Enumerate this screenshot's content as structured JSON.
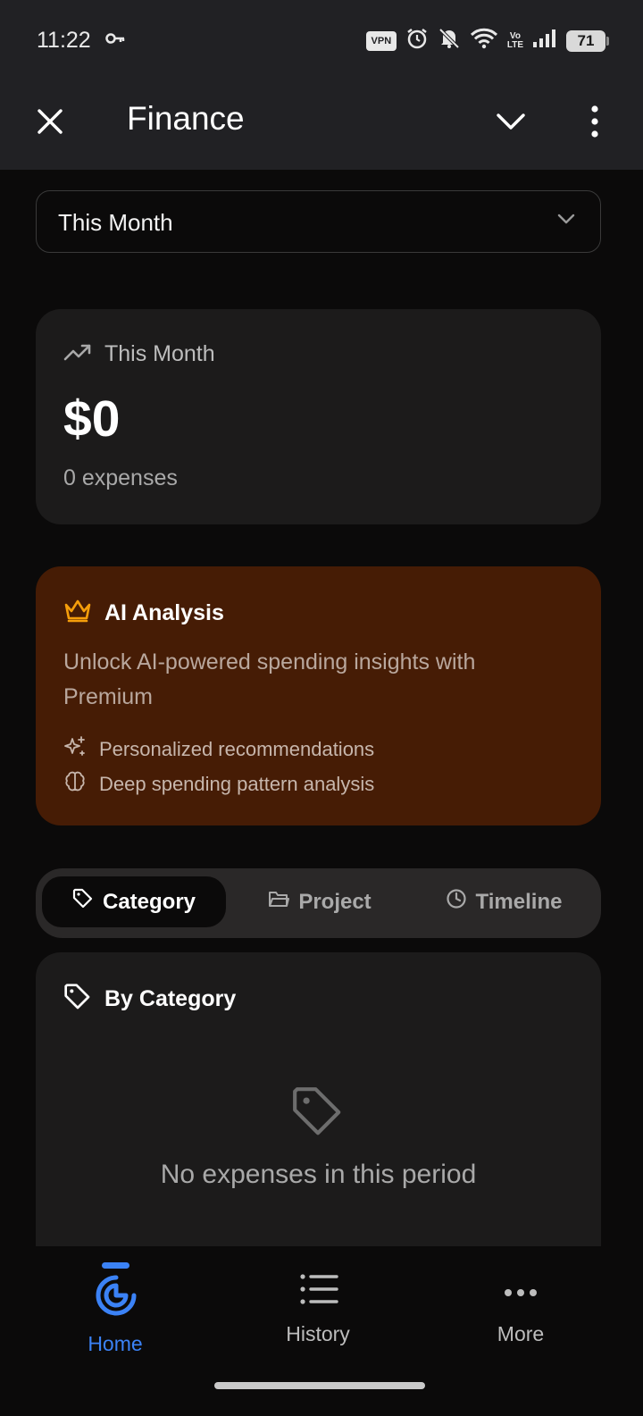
{
  "status_bar": {
    "time": "11:22",
    "vpn": "VPN",
    "volte_top": "Vo",
    "volte_bottom": "LTE",
    "battery": "71",
    "icons": [
      "key-icon",
      "vpn-icon",
      "alarm-icon",
      "bell-off-icon",
      "wifi-icon",
      "volte-icon",
      "signal-icon",
      "battery-icon"
    ]
  },
  "app_bar": {
    "title": "Finance",
    "icons": [
      "close-icon",
      "chevron-down-icon",
      "more-vertical-icon"
    ]
  },
  "period_select": {
    "value": "This Month"
  },
  "summary": {
    "label": "This Month",
    "amount": "$0",
    "count": "0 expenses"
  },
  "ai_card": {
    "title": "AI Analysis",
    "description": "Unlock AI-powered spending insights with Premium",
    "features": [
      "Personalized recommendations",
      "Deep spending pattern analysis"
    ],
    "accent": "#f59e0b",
    "background": "#461c05"
  },
  "tabs": [
    {
      "label": "Category",
      "active": true,
      "icon": "tag-icon"
    },
    {
      "label": "Project",
      "active": false,
      "icon": "folder-icon"
    },
    {
      "label": "Timeline",
      "active": false,
      "icon": "clock-icon"
    }
  ],
  "by_category": {
    "title": "By Category",
    "empty_text": "No expenses in this period"
  },
  "bottom_nav": [
    {
      "label": "Home",
      "active": true,
      "icon": "pie-chart-icon"
    },
    {
      "label": "History",
      "active": false,
      "icon": "list-icon"
    },
    {
      "label": "More",
      "active": false,
      "icon": "more-horizontal-icon"
    }
  ],
  "colors": {
    "active_blue": "#3b82f6",
    "surface": "#1c1b1b",
    "appbar": "#212124"
  }
}
